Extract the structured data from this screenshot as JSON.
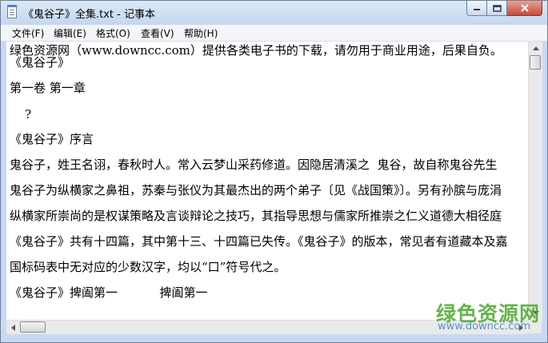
{
  "window": {
    "title": "《鬼谷子》全集.txt - 记事本",
    "controls": [
      "minimize-icon",
      "maximize-icon",
      "close-icon"
    ]
  },
  "menu": {
    "file": "文件(F)",
    "edit": "编辑(E)",
    "format": "格式(O)",
    "view": "查看(V)",
    "help": "帮助(H)"
  },
  "document": {
    "lines": [
      "绿色资源网（www.downcc.com）提供各类电子书的下载，请勿用于商业用途，后果自负。",
      "《鬼谷子》",
      "第一卷 第一章",
      "    ?",
      "《鬼谷子》序言",
      "鬼谷子，姓王名诩，春秋时人。常入云梦山采药修道。因隐居清溪之  鬼谷，故自称鬼谷先生",
      "鬼谷子为纵横家之鼻祖，苏秦与张仪为其最杰出的两个弟子〔见《战国策》〕。另有孙膑与庞涓",
      "纵横家所崇尚的是权谋策略及言谈辩论之技巧，其指导思想与儒家所推崇之仁义道德大相径庭",
      "《鬼谷子》共有十四篇，其中第十三、十四篇已失传。《鬼谷子》的版本，常见者有道藏本及嘉",
      "国标码表中无对应的少数汉字，均以“口”符号代之。",
      "《鬼谷子》捭阖第一           捭阖第一"
    ]
  },
  "scrollbars": {
    "vertical": [
      "scroll-up-arrow-icon",
      "scroll-down-arrow-icon"
    ],
    "horizontal": [
      "scroll-left-arrow-icon",
      "scroll-right-arrow-icon"
    ]
  },
  "watermark": {
    "brand": "绿色资源网",
    "url": "www.downcc.com"
  },
  "colors": {
    "title_bar": "#c9daf0",
    "close_button": "#c8493a",
    "watermark_green": "#4aa72e",
    "watermark_blue": "#2a83c6"
  }
}
